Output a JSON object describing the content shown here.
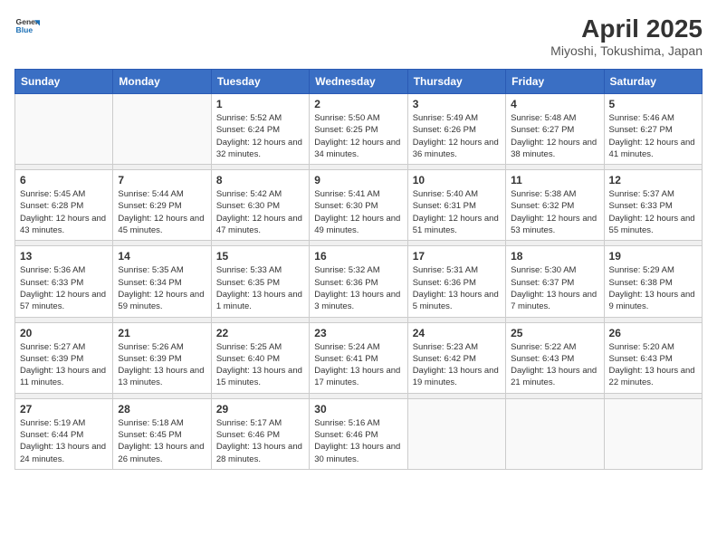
{
  "header": {
    "logo_general": "General",
    "logo_blue": "Blue",
    "title": "April 2025",
    "subtitle": "Miyoshi, Tokushima, Japan"
  },
  "weekdays": [
    "Sunday",
    "Monday",
    "Tuesday",
    "Wednesday",
    "Thursday",
    "Friday",
    "Saturday"
  ],
  "weeks": [
    [
      {
        "day": "",
        "info": ""
      },
      {
        "day": "",
        "info": ""
      },
      {
        "day": "1",
        "info": "Sunrise: 5:52 AM\nSunset: 6:24 PM\nDaylight: 12 hours and 32 minutes."
      },
      {
        "day": "2",
        "info": "Sunrise: 5:50 AM\nSunset: 6:25 PM\nDaylight: 12 hours and 34 minutes."
      },
      {
        "day": "3",
        "info": "Sunrise: 5:49 AM\nSunset: 6:26 PM\nDaylight: 12 hours and 36 minutes."
      },
      {
        "day": "4",
        "info": "Sunrise: 5:48 AM\nSunset: 6:27 PM\nDaylight: 12 hours and 38 minutes."
      },
      {
        "day": "5",
        "info": "Sunrise: 5:46 AM\nSunset: 6:27 PM\nDaylight: 12 hours and 41 minutes."
      }
    ],
    [
      {
        "day": "6",
        "info": "Sunrise: 5:45 AM\nSunset: 6:28 PM\nDaylight: 12 hours and 43 minutes."
      },
      {
        "day": "7",
        "info": "Sunrise: 5:44 AM\nSunset: 6:29 PM\nDaylight: 12 hours and 45 minutes."
      },
      {
        "day": "8",
        "info": "Sunrise: 5:42 AM\nSunset: 6:30 PM\nDaylight: 12 hours and 47 minutes."
      },
      {
        "day": "9",
        "info": "Sunrise: 5:41 AM\nSunset: 6:30 PM\nDaylight: 12 hours and 49 minutes."
      },
      {
        "day": "10",
        "info": "Sunrise: 5:40 AM\nSunset: 6:31 PM\nDaylight: 12 hours and 51 minutes."
      },
      {
        "day": "11",
        "info": "Sunrise: 5:38 AM\nSunset: 6:32 PM\nDaylight: 12 hours and 53 minutes."
      },
      {
        "day": "12",
        "info": "Sunrise: 5:37 AM\nSunset: 6:33 PM\nDaylight: 12 hours and 55 minutes."
      }
    ],
    [
      {
        "day": "13",
        "info": "Sunrise: 5:36 AM\nSunset: 6:33 PM\nDaylight: 12 hours and 57 minutes."
      },
      {
        "day": "14",
        "info": "Sunrise: 5:35 AM\nSunset: 6:34 PM\nDaylight: 12 hours and 59 minutes."
      },
      {
        "day": "15",
        "info": "Sunrise: 5:33 AM\nSunset: 6:35 PM\nDaylight: 13 hours and 1 minute."
      },
      {
        "day": "16",
        "info": "Sunrise: 5:32 AM\nSunset: 6:36 PM\nDaylight: 13 hours and 3 minutes."
      },
      {
        "day": "17",
        "info": "Sunrise: 5:31 AM\nSunset: 6:36 PM\nDaylight: 13 hours and 5 minutes."
      },
      {
        "day": "18",
        "info": "Sunrise: 5:30 AM\nSunset: 6:37 PM\nDaylight: 13 hours and 7 minutes."
      },
      {
        "day": "19",
        "info": "Sunrise: 5:29 AM\nSunset: 6:38 PM\nDaylight: 13 hours and 9 minutes."
      }
    ],
    [
      {
        "day": "20",
        "info": "Sunrise: 5:27 AM\nSunset: 6:39 PM\nDaylight: 13 hours and 11 minutes."
      },
      {
        "day": "21",
        "info": "Sunrise: 5:26 AM\nSunset: 6:39 PM\nDaylight: 13 hours and 13 minutes."
      },
      {
        "day": "22",
        "info": "Sunrise: 5:25 AM\nSunset: 6:40 PM\nDaylight: 13 hours and 15 minutes."
      },
      {
        "day": "23",
        "info": "Sunrise: 5:24 AM\nSunset: 6:41 PM\nDaylight: 13 hours and 17 minutes."
      },
      {
        "day": "24",
        "info": "Sunrise: 5:23 AM\nSunset: 6:42 PM\nDaylight: 13 hours and 19 minutes."
      },
      {
        "day": "25",
        "info": "Sunrise: 5:22 AM\nSunset: 6:43 PM\nDaylight: 13 hours and 21 minutes."
      },
      {
        "day": "26",
        "info": "Sunrise: 5:20 AM\nSunset: 6:43 PM\nDaylight: 13 hours and 22 minutes."
      }
    ],
    [
      {
        "day": "27",
        "info": "Sunrise: 5:19 AM\nSunset: 6:44 PM\nDaylight: 13 hours and 24 minutes."
      },
      {
        "day": "28",
        "info": "Sunrise: 5:18 AM\nSunset: 6:45 PM\nDaylight: 13 hours and 26 minutes."
      },
      {
        "day": "29",
        "info": "Sunrise: 5:17 AM\nSunset: 6:46 PM\nDaylight: 13 hours and 28 minutes."
      },
      {
        "day": "30",
        "info": "Sunrise: 5:16 AM\nSunset: 6:46 PM\nDaylight: 13 hours and 30 minutes."
      },
      {
        "day": "",
        "info": ""
      },
      {
        "day": "",
        "info": ""
      },
      {
        "day": "",
        "info": ""
      }
    ]
  ]
}
